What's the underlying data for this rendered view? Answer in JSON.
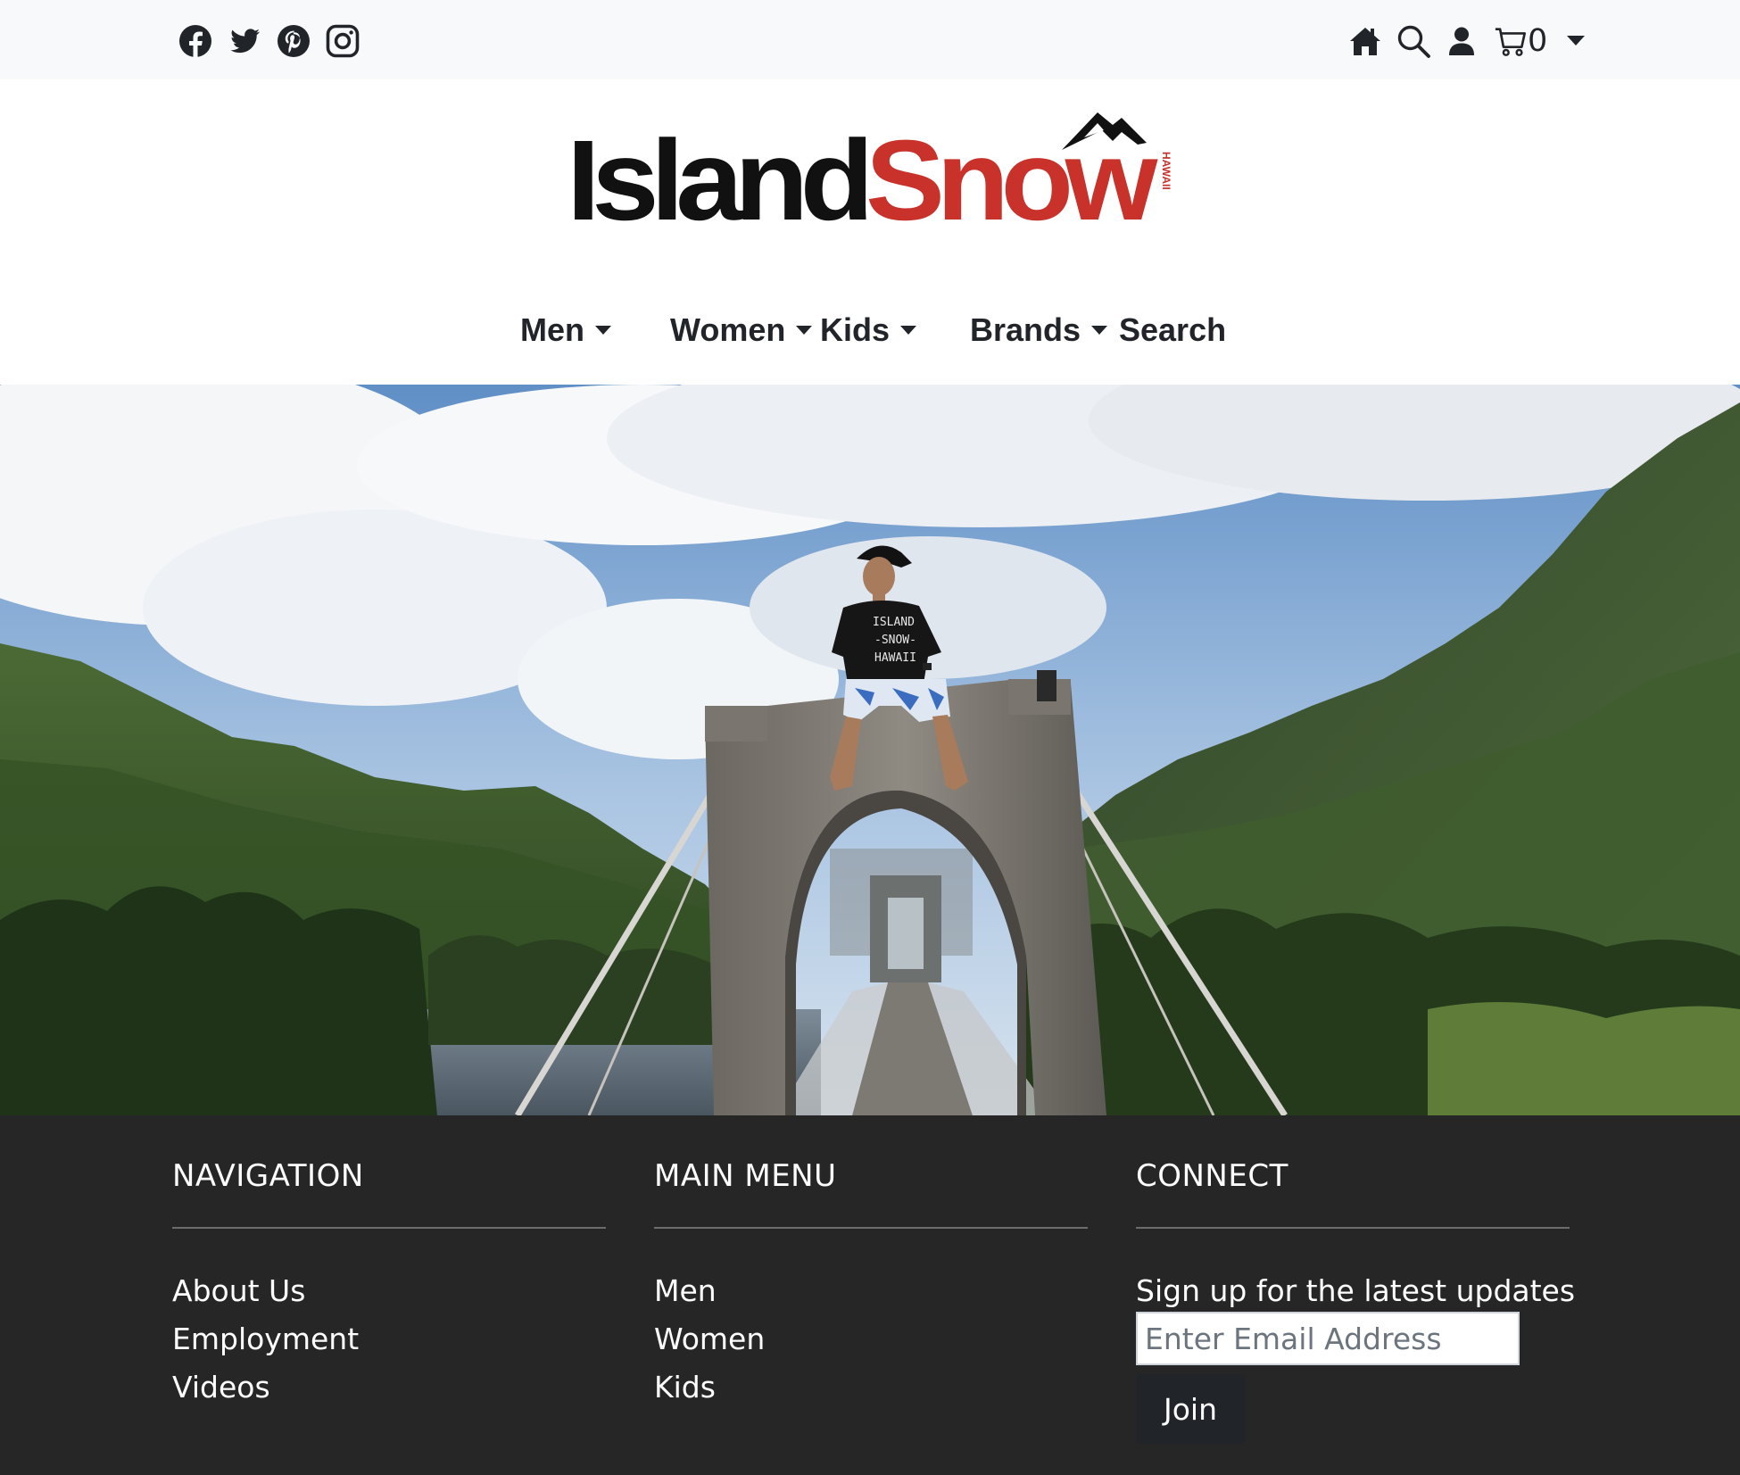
{
  "header": {
    "social_icons": [
      "facebook-icon",
      "twitter-icon",
      "pinterest-icon",
      "instagram-icon"
    ],
    "utility_icons": [
      "home-icon",
      "search-icon",
      "user-icon",
      "cart-icon"
    ],
    "cart_count": "0"
  },
  "logo": {
    "word_black": "Island",
    "word_red": "Snow",
    "tag": "HAWAII",
    "colors": {
      "black": "#111111",
      "red": "#c8322b"
    }
  },
  "nav": {
    "items": [
      {
        "label": "Men",
        "dropdown": true
      },
      {
        "label": "Women",
        "dropdown": true
      },
      {
        "label": "Kids",
        "dropdown": true
      },
      {
        "label": "Brands",
        "dropdown": true
      },
      {
        "label": "Search",
        "dropdown": false
      }
    ]
  },
  "hero": {
    "shirt_lines": [
      "ISLAND",
      "-SNOW-",
      "HAWAII"
    ]
  },
  "footer": {
    "navigation": {
      "heading": "NAVIGATION",
      "links": [
        "About Us",
        "Employment",
        "Videos"
      ]
    },
    "main_menu": {
      "heading": "MAIN MENU",
      "links": [
        "Men",
        "Women",
        "Kids"
      ]
    },
    "connect": {
      "heading": "CONNECT",
      "signup_text": "Sign up for the latest updates",
      "email_placeholder": "Enter Email Address",
      "join_label": "Join"
    },
    "colors": {
      "background": "#262626",
      "rule": "#6c6c6c"
    }
  }
}
